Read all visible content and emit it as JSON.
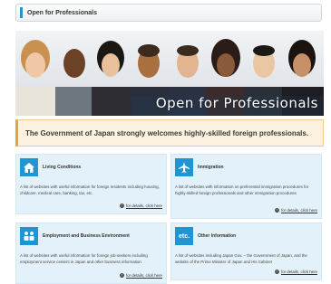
{
  "header": {
    "title": "Open for Professionals"
  },
  "banner": {
    "caption": "Open for Professionals"
  },
  "notice": {
    "text": "The Government of Japan strongly welcomes highly-skilled foreign professionals."
  },
  "cards": [
    {
      "icon": "house-icon",
      "title": "Living Conditions",
      "desc": "A list of websites with useful information for foreign residents including housing, childcare, medical care, banking, tax, etc.",
      "link": "for details, click here"
    },
    {
      "icon": "airplane-icon",
      "title": "Immigration",
      "desc": "A list of websites with information on preferential immigration procedures for highly-skilled foreign professionals and other immigration procedures",
      "link": "for details, click here"
    },
    {
      "icon": "people-icon",
      "title": "Employment and Business Environment",
      "desc": "A list of websites with useful information for foreign job-seekers including employment service centers in Japan and other business information",
      "link": "for details, click here"
    },
    {
      "icon": "etc-icon",
      "icon_text": "etc.",
      "title": "Other Information",
      "desc": "A list of websites including Japan Gov. – the Government of Japan, and the website of the Prime Minister of Japan and His Cabinet",
      "link": "for details, click here"
    }
  ],
  "colors": {
    "accent_blue": "#1f95d3",
    "notice_bg": "#fdf2df",
    "card_bg": "#e3f2fa"
  }
}
